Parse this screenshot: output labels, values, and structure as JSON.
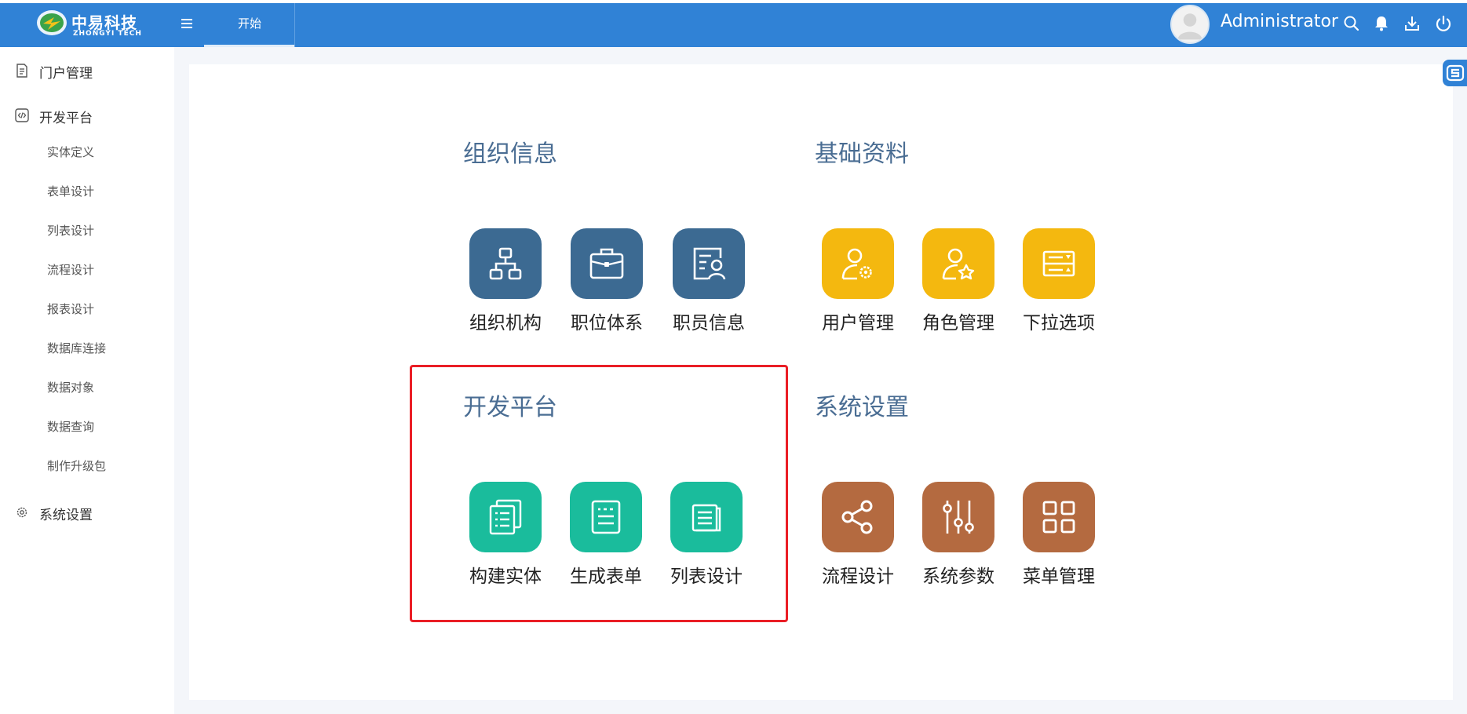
{
  "header": {
    "logo_cn": "中易科技",
    "logo_en": "ZHONGYI TECH",
    "menu_icon": "hamburger-icon",
    "active_tab": "开始",
    "username": "Administrator",
    "icons": [
      "search-icon",
      "bell-icon",
      "download-icon",
      "power-icon"
    ],
    "bg_color": "#3082d6"
  },
  "sidebar": {
    "groups": [
      {
        "label": "门户管理",
        "icon": "document-icon"
      },
      {
        "label": "开发平台",
        "icon": "code-icon"
      },
      {
        "label": "系统设置",
        "icon": "gear-icon"
      }
    ],
    "dev_items": [
      "实体定义",
      "表单设计",
      "列表设计",
      "流程设计",
      "报表设计",
      "数据库连接",
      "数据对象",
      "数据查询",
      "制作升级包"
    ]
  },
  "sections": {
    "org": {
      "title": "组织信息",
      "color": "#3c6a92",
      "tiles": [
        {
          "label": "组织机构",
          "icon": "org-chart-icon"
        },
        {
          "label": "职位体系",
          "icon": "briefcase-icon"
        },
        {
          "label": "职员信息",
          "icon": "employee-card-icon"
        }
      ]
    },
    "basic": {
      "title": "基础资料",
      "color": "#f4b80f",
      "tiles": [
        {
          "label": "用户管理",
          "icon": "user-gear-icon"
        },
        {
          "label": "角色管理",
          "icon": "user-star-icon"
        },
        {
          "label": "下拉选项",
          "icon": "dropdown-list-icon"
        }
      ]
    },
    "dev": {
      "title": "开发平台",
      "color": "#1abc9c",
      "tiles": [
        {
          "label": "构建实体",
          "icon": "stacked-pages-icon"
        },
        {
          "label": "生成表单",
          "icon": "form-icon"
        },
        {
          "label": "列表设计",
          "icon": "list-doc-icon"
        }
      ]
    },
    "sys": {
      "title": "系统设置",
      "color": "#b46a40",
      "tiles": [
        {
          "label": "流程设计",
          "icon": "share-icon"
        },
        {
          "label": "系统参数",
          "icon": "sliders-icon"
        },
        {
          "label": "菜单管理",
          "icon": "grid-icon"
        }
      ]
    }
  },
  "highlight_color": "#ea1e26"
}
